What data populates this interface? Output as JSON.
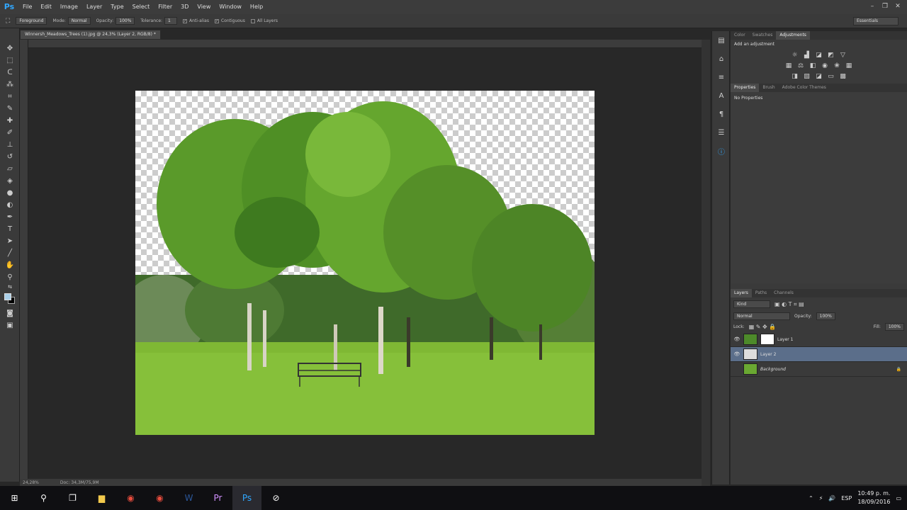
{
  "app": {
    "logo": "Ps",
    "menus": [
      "File",
      "Edit",
      "Image",
      "Layer",
      "Type",
      "Select",
      "Filter",
      "3D",
      "View",
      "Window",
      "Help"
    ]
  },
  "options": {
    "preset": "Foreground",
    "mode_label": "Mode:",
    "mode": "Normal",
    "opacity_label": "Opacity:",
    "opacity": "100%",
    "tolerance_label": "Tolerance:",
    "tolerance": "1",
    "antialias": "Anti-alias",
    "contiguous": "Contiguous",
    "all_layers": "All Layers",
    "workspace": "Essentials"
  },
  "document": {
    "tab": "Winnersh_Meadows_Trees (1).jpg @ 24,3% (Layer 2, RGB/8) *",
    "zoom": "24,28%",
    "doc_size": "Doc: 34,3M/75,9M"
  },
  "panels": {
    "top_tabs": [
      "Color",
      "Swatches",
      "Adjustments"
    ],
    "add_adjustment": "Add an adjustment",
    "prop_tabs": [
      "Properties",
      "Brush",
      "Adobe Color Themes"
    ],
    "no_properties": "No Properties",
    "layer_tabs": [
      "Layers",
      "Paths",
      "Channels"
    ],
    "kind": "Kind",
    "blend": "Normal",
    "opacity_label": "Opacity:",
    "opacity": "100%",
    "lock_label": "Lock:",
    "fill_label": "Fill:",
    "fill": "100%",
    "layers": [
      {
        "name": "Layer 1"
      },
      {
        "name": "Layer 2"
      },
      {
        "name": "Background"
      }
    ]
  },
  "taskbar": {
    "lang": "ESP",
    "time": "10:49 p. m.",
    "date": "18/09/2016"
  },
  "colors": {
    "accent": "#31a8ff",
    "selected_layer": "#5b6e8a"
  }
}
